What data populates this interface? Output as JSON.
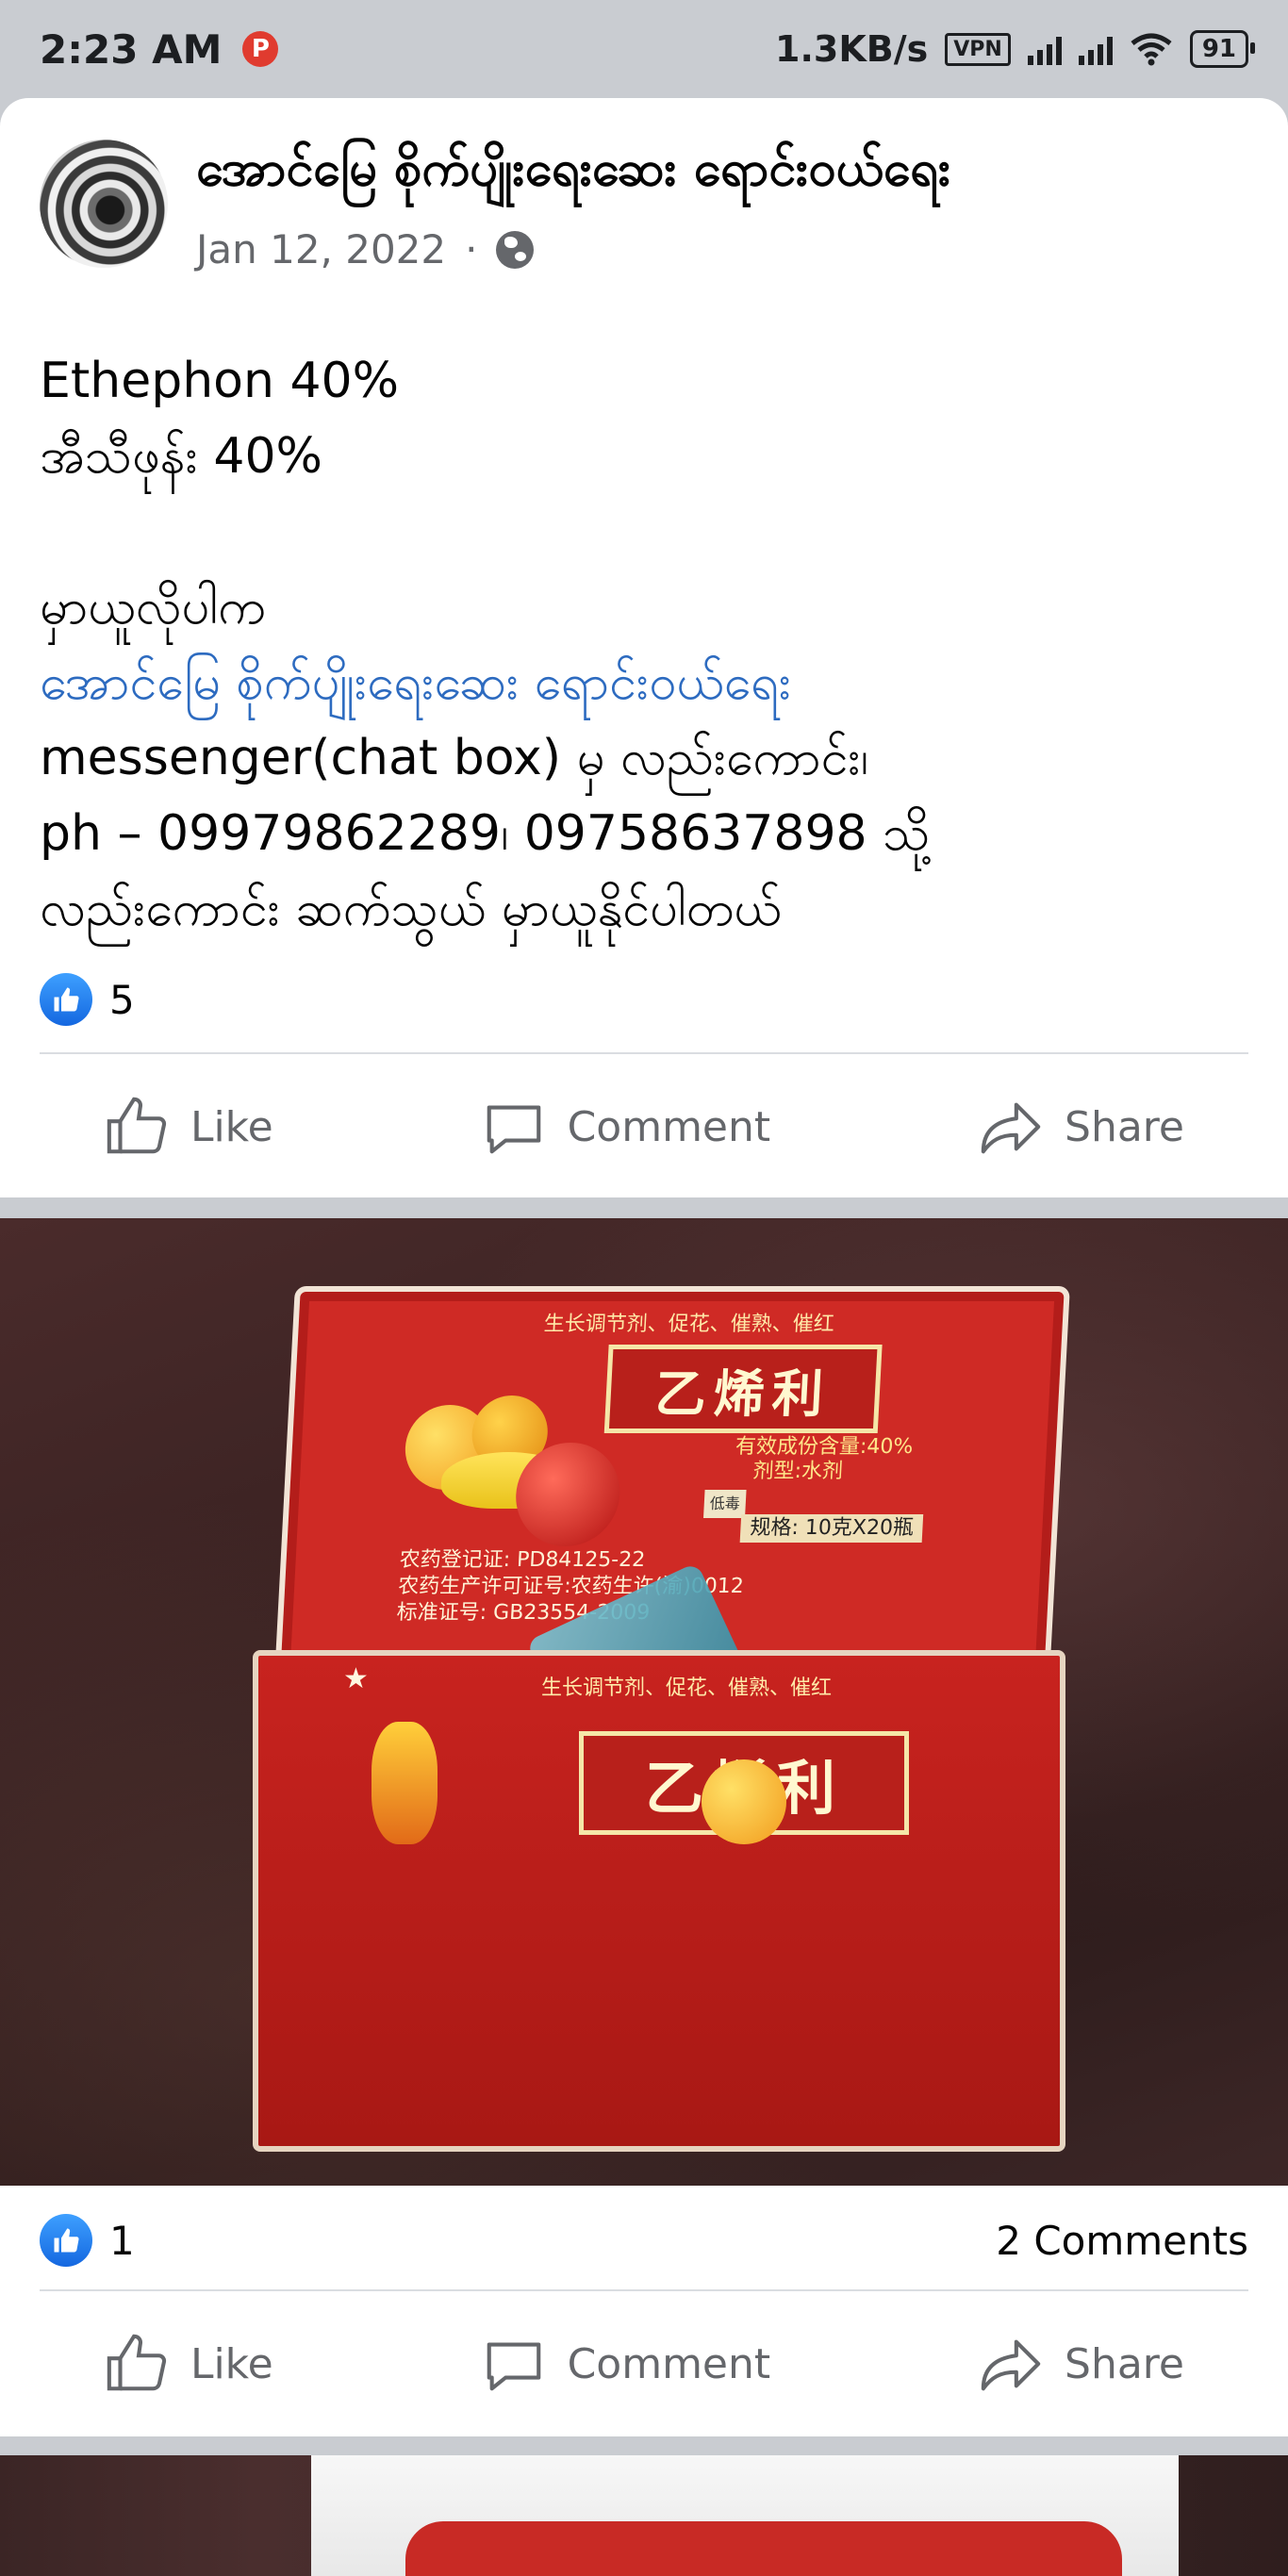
{
  "status_bar": {
    "time": "2:23 AM",
    "app_badge": "P",
    "net_speed": "1.3KB/s",
    "vpn": "VPN",
    "battery": "91"
  },
  "post": {
    "page_name": "အောင်မြေ စိုက်ပျိုးရေးဆေး ရောင်းဝယ်ရေး",
    "date": "Jan 12, 2022",
    "separator": "·",
    "privacy_icon": "globe-icon",
    "lines": [
      "Ethephon 40%",
      "အီသီဖုန်း 40%",
      "",
      "မှာယူလိုပါက",
      "အောင်မြေ စိုက်ပျိုးရေးဆေး ရောင်းဝယ်ရေး",
      "messenger(chat box) မှ လည်းကောင်း၊",
      "ph – 09979862289၊ 09758637898 သို့",
      "လည်းကောင်း ဆက်သွယ် မှာယူနိုင်ပါတယ်"
    ],
    "link_line_index": 4,
    "reaction_count": "5"
  },
  "actions": {
    "like": "Like",
    "comment": "Comment",
    "share": "Share"
  },
  "photo_post": {
    "reaction_count": "1",
    "comments": "2 Comments"
  },
  "box_label": {
    "name_cn": "乙烯利",
    "top_band": "生长调节剂、促花、催熟、催红",
    "content": "有效成份含量:40%",
    "form": "剂型:水剂",
    "spec": "规格: 10克X20瓶",
    "reg1": "农药登记证: PD84125-22",
    "reg2": "农药生产许可证号:农药生许(渝)0012",
    "reg3": "标准证号: GB23554-2009",
    "stamp": "低毒"
  },
  "colors": {
    "link": "#2d6bc0",
    "like_blue": "#1877f2",
    "meta_gray": "#65676b"
  }
}
